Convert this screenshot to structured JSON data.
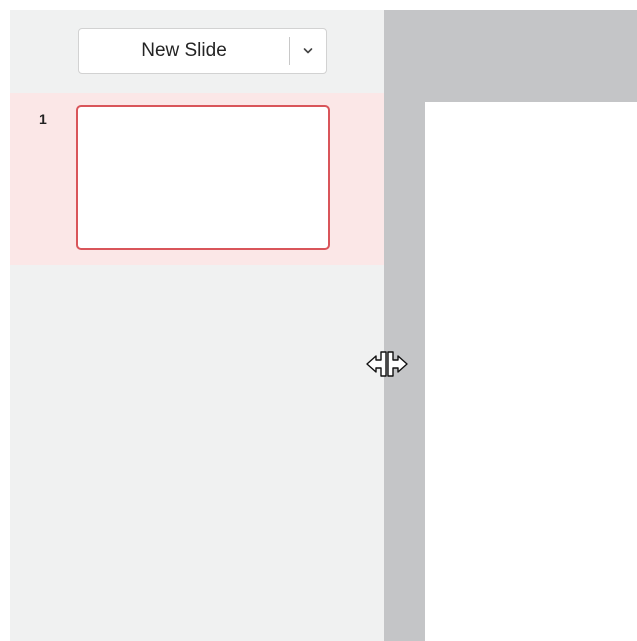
{
  "toolbar": {
    "new_slide_label": "New Slide",
    "new_slide_dropdown_icon": "chevron-down-icon"
  },
  "slides": [
    {
      "number": "1",
      "selected": true
    }
  ],
  "colors": {
    "thumbnail_pane_bg": "#f0f1f1",
    "selected_row_bg": "#fbe7e7",
    "selected_border": "#d9555a",
    "workspace_bg": "#c4c5c7",
    "slide_bg": "#ffffff"
  },
  "cursor": "resize-horizontal-icon"
}
